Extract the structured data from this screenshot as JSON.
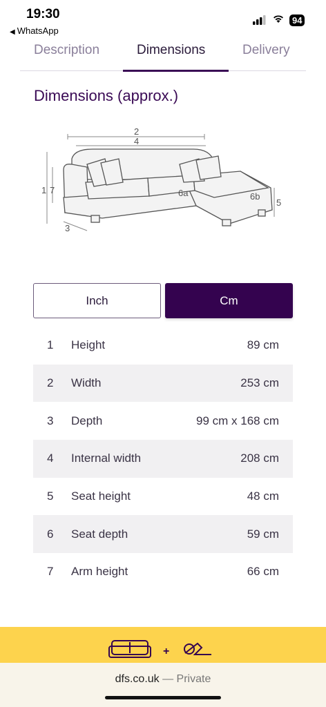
{
  "status_bar": {
    "time": "19:30",
    "back_app": "WhatsApp",
    "battery": "94"
  },
  "tabs": [
    {
      "label": "Description"
    },
    {
      "label": "Dimensions"
    },
    {
      "label": "Delivery"
    }
  ],
  "section_title": "Dimensions (approx.)",
  "diagram": {
    "labels": [
      "2",
      "4",
      "1",
      "7",
      "6a",
      "6b",
      "5",
      "3"
    ]
  },
  "unit_toggle": {
    "inch_label": "Inch",
    "cm_label": "Cm",
    "selected": "Cm"
  },
  "dimensions": [
    {
      "num": "1",
      "label": "Height",
      "value": "89 cm"
    },
    {
      "num": "2",
      "label": "Width",
      "value": "253 cm"
    },
    {
      "num": "3",
      "label": "Depth",
      "value": "99 cm x 168 cm"
    },
    {
      "num": "4",
      "label": "Internal width",
      "value": "208 cm"
    },
    {
      "num": "5",
      "label": "Seat height",
      "value": "48 cm"
    },
    {
      "num": "6",
      "label": "Seat depth",
      "value": "59 cm"
    },
    {
      "num": "7",
      "label": "Arm height",
      "value": "66 cm"
    }
  ],
  "browser": {
    "domain": "dfs.co.uk",
    "mode": "— Private"
  },
  "colors": {
    "brand_purple": "#34034f",
    "banner_yellow": "#fdd34d"
  }
}
